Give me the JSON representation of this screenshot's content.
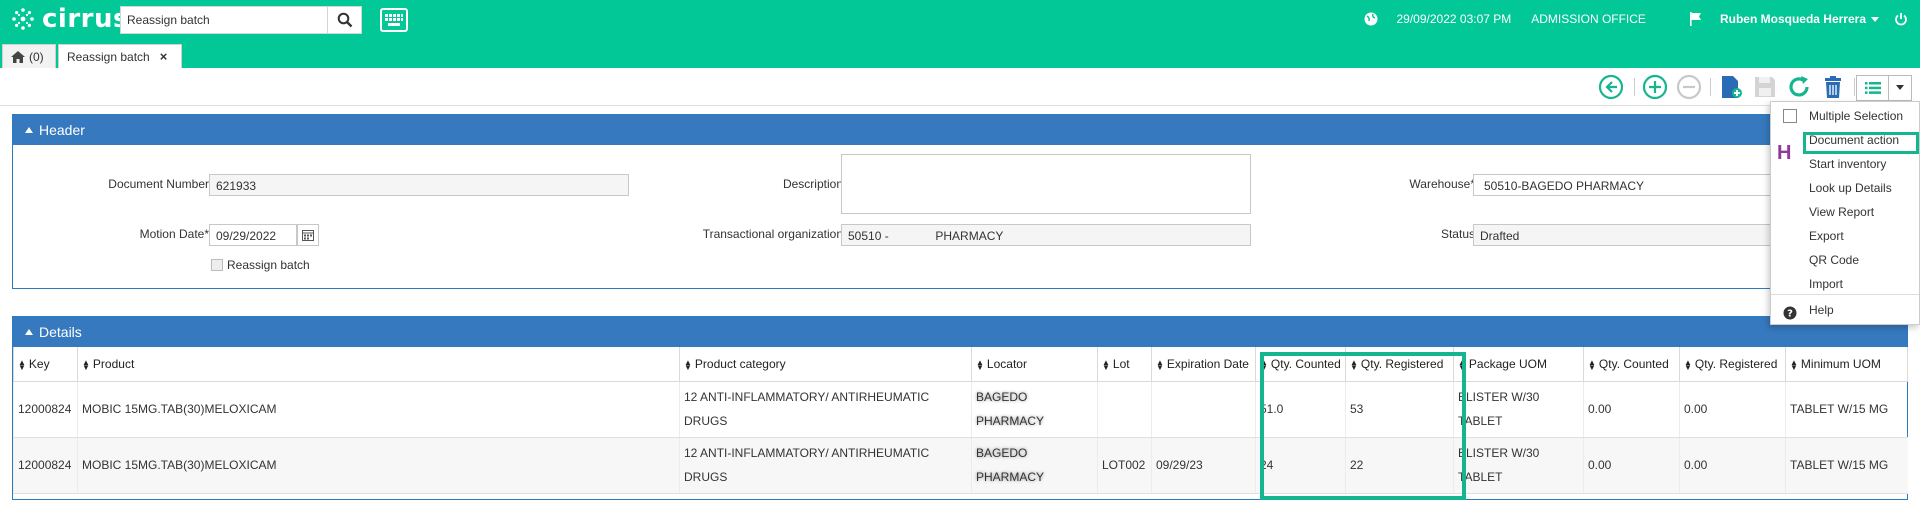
{
  "app": {
    "name": "cirrus"
  },
  "search": {
    "value": "Reassign batch"
  },
  "topbar": {
    "datetime": "29/09/2022 03:07 PM",
    "office": "ADMISSION OFFICE",
    "user": "Ruben Mosqueda Herrera"
  },
  "tabs": {
    "home_label": "(0)",
    "active_label": "Reassign batch"
  },
  "header": {
    "title": "Header",
    "document_number_label": "Document Number",
    "document_number": "621933",
    "description_label": "Description",
    "warehouse_label": "Warehouse*",
    "warehouse": "50510-BAGEDO PHARMACY",
    "motion_date_label": "Motion Date*",
    "motion_date": "09/29/2022",
    "trans_org_label": "Transactional organization",
    "trans_org": "50510 -              PHARMACY",
    "status_label": "Status",
    "status": "Drafted",
    "reassign_label": "Reassign batch"
  },
  "details": {
    "title": "Details",
    "columns": [
      "Key",
      "Product",
      "Product category",
      "Locator",
      "Lot",
      "Expiration Date",
      "Qty. Counted",
      "Qty. Registered",
      "Package UOM",
      "Qty. Counted",
      "Qty. Registered",
      "Minimum UOM"
    ],
    "rows": [
      {
        "key": "12000824",
        "product": "MOBIC 15MG.TAB(30)MELOXICAM",
        "category": "12 ANTI-INFLAMMATORY/ ANTIRHEUMATIC DRUGS",
        "locator": "BAGEDO PHARMACY",
        "lot": "",
        "exp": "",
        "qty_counted": "51.0",
        "qty_registered": "53",
        "package_uom": "BLISTER W/30 TABLET",
        "qty_counted2": "0.00",
        "qty_registered2": "0.00",
        "min_uom": "TABLET W/15 MG"
      },
      {
        "key": "12000824",
        "product": "MOBIC 15MG.TAB(30)MELOXICAM",
        "category": "12 ANTI-INFLAMMATORY/ ANTIRHEUMATIC DRUGS",
        "locator": "BAGEDO PHARMACY",
        "lot": "LOT002",
        "exp": "09/29/23",
        "qty_counted": "24",
        "qty_registered": "22",
        "package_uom": "BLISTER W/30 TABLET",
        "qty_counted2": "0.00",
        "qty_registered2": "0.00",
        "min_uom": "TABLET W/15 MG"
      }
    ]
  },
  "menu": {
    "items": [
      "Multiple Selection",
      "Document action",
      "Start inventory",
      "Look up Details",
      "View Report",
      "Export",
      "QR Code",
      "Import",
      "Help"
    ],
    "mark": "H"
  },
  "colors": {
    "brand": "#02c796",
    "panel_blue": "#3679be",
    "highlight": "#15b58f"
  }
}
